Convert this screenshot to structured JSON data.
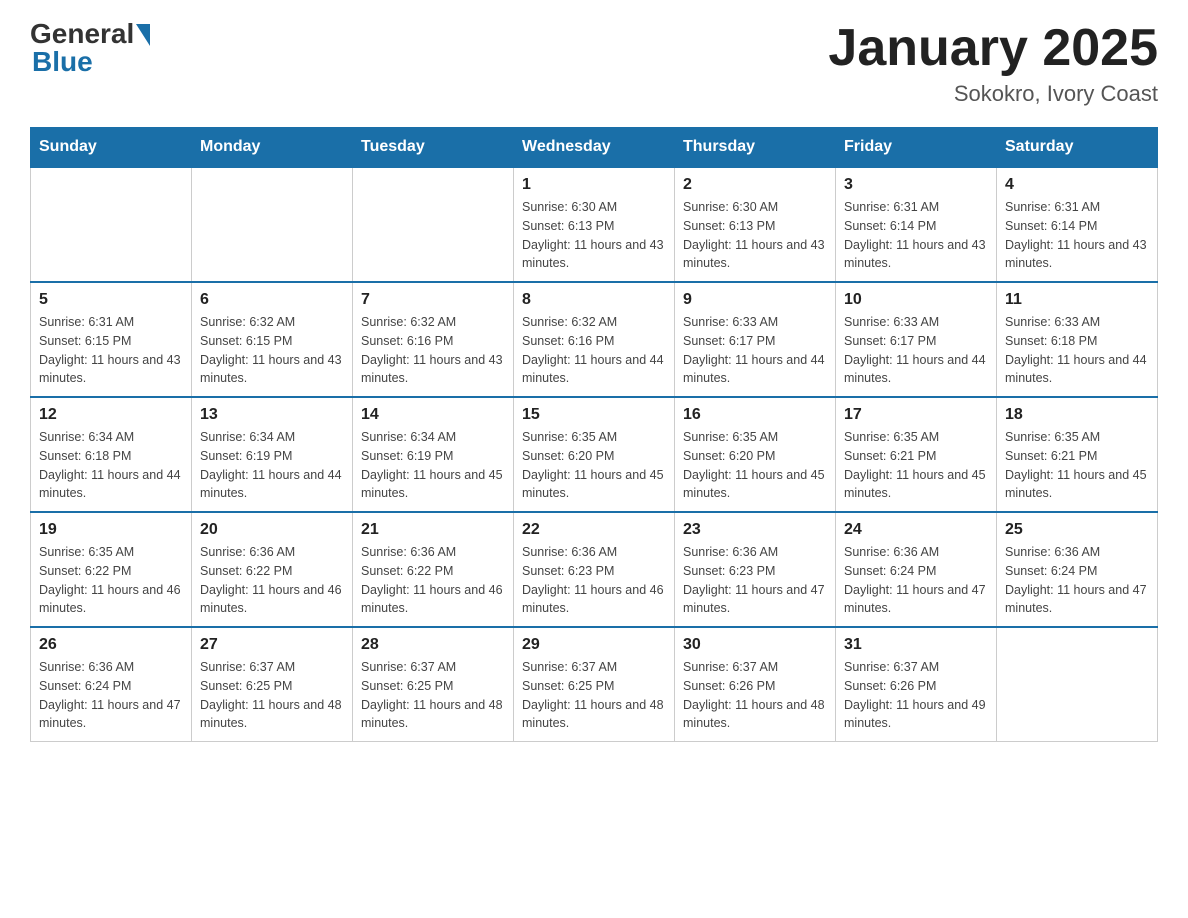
{
  "header": {
    "logo": {
      "general": "General",
      "blue": "Blue"
    },
    "title": "January 2025",
    "subtitle": "Sokokro, Ivory Coast"
  },
  "days_of_week": [
    "Sunday",
    "Monday",
    "Tuesday",
    "Wednesday",
    "Thursday",
    "Friday",
    "Saturday"
  ],
  "weeks": [
    [
      {
        "day": "",
        "info": ""
      },
      {
        "day": "",
        "info": ""
      },
      {
        "day": "",
        "info": ""
      },
      {
        "day": "1",
        "info": "Sunrise: 6:30 AM\nSunset: 6:13 PM\nDaylight: 11 hours and 43 minutes."
      },
      {
        "day": "2",
        "info": "Sunrise: 6:30 AM\nSunset: 6:13 PM\nDaylight: 11 hours and 43 minutes."
      },
      {
        "day": "3",
        "info": "Sunrise: 6:31 AM\nSunset: 6:14 PM\nDaylight: 11 hours and 43 minutes."
      },
      {
        "day": "4",
        "info": "Sunrise: 6:31 AM\nSunset: 6:14 PM\nDaylight: 11 hours and 43 minutes."
      }
    ],
    [
      {
        "day": "5",
        "info": "Sunrise: 6:31 AM\nSunset: 6:15 PM\nDaylight: 11 hours and 43 minutes."
      },
      {
        "day": "6",
        "info": "Sunrise: 6:32 AM\nSunset: 6:15 PM\nDaylight: 11 hours and 43 minutes."
      },
      {
        "day": "7",
        "info": "Sunrise: 6:32 AM\nSunset: 6:16 PM\nDaylight: 11 hours and 43 minutes."
      },
      {
        "day": "8",
        "info": "Sunrise: 6:32 AM\nSunset: 6:16 PM\nDaylight: 11 hours and 44 minutes."
      },
      {
        "day": "9",
        "info": "Sunrise: 6:33 AM\nSunset: 6:17 PM\nDaylight: 11 hours and 44 minutes."
      },
      {
        "day": "10",
        "info": "Sunrise: 6:33 AM\nSunset: 6:17 PM\nDaylight: 11 hours and 44 minutes."
      },
      {
        "day": "11",
        "info": "Sunrise: 6:33 AM\nSunset: 6:18 PM\nDaylight: 11 hours and 44 minutes."
      }
    ],
    [
      {
        "day": "12",
        "info": "Sunrise: 6:34 AM\nSunset: 6:18 PM\nDaylight: 11 hours and 44 minutes."
      },
      {
        "day": "13",
        "info": "Sunrise: 6:34 AM\nSunset: 6:19 PM\nDaylight: 11 hours and 44 minutes."
      },
      {
        "day": "14",
        "info": "Sunrise: 6:34 AM\nSunset: 6:19 PM\nDaylight: 11 hours and 45 minutes."
      },
      {
        "day": "15",
        "info": "Sunrise: 6:35 AM\nSunset: 6:20 PM\nDaylight: 11 hours and 45 minutes."
      },
      {
        "day": "16",
        "info": "Sunrise: 6:35 AM\nSunset: 6:20 PM\nDaylight: 11 hours and 45 minutes."
      },
      {
        "day": "17",
        "info": "Sunrise: 6:35 AM\nSunset: 6:21 PM\nDaylight: 11 hours and 45 minutes."
      },
      {
        "day": "18",
        "info": "Sunrise: 6:35 AM\nSunset: 6:21 PM\nDaylight: 11 hours and 45 minutes."
      }
    ],
    [
      {
        "day": "19",
        "info": "Sunrise: 6:35 AM\nSunset: 6:22 PM\nDaylight: 11 hours and 46 minutes."
      },
      {
        "day": "20",
        "info": "Sunrise: 6:36 AM\nSunset: 6:22 PM\nDaylight: 11 hours and 46 minutes."
      },
      {
        "day": "21",
        "info": "Sunrise: 6:36 AM\nSunset: 6:22 PM\nDaylight: 11 hours and 46 minutes."
      },
      {
        "day": "22",
        "info": "Sunrise: 6:36 AM\nSunset: 6:23 PM\nDaylight: 11 hours and 46 minutes."
      },
      {
        "day": "23",
        "info": "Sunrise: 6:36 AM\nSunset: 6:23 PM\nDaylight: 11 hours and 47 minutes."
      },
      {
        "day": "24",
        "info": "Sunrise: 6:36 AM\nSunset: 6:24 PM\nDaylight: 11 hours and 47 minutes."
      },
      {
        "day": "25",
        "info": "Sunrise: 6:36 AM\nSunset: 6:24 PM\nDaylight: 11 hours and 47 minutes."
      }
    ],
    [
      {
        "day": "26",
        "info": "Sunrise: 6:36 AM\nSunset: 6:24 PM\nDaylight: 11 hours and 47 minutes."
      },
      {
        "day": "27",
        "info": "Sunrise: 6:37 AM\nSunset: 6:25 PM\nDaylight: 11 hours and 48 minutes."
      },
      {
        "day": "28",
        "info": "Sunrise: 6:37 AM\nSunset: 6:25 PM\nDaylight: 11 hours and 48 minutes."
      },
      {
        "day": "29",
        "info": "Sunrise: 6:37 AM\nSunset: 6:25 PM\nDaylight: 11 hours and 48 minutes."
      },
      {
        "day": "30",
        "info": "Sunrise: 6:37 AM\nSunset: 6:26 PM\nDaylight: 11 hours and 48 minutes."
      },
      {
        "day": "31",
        "info": "Sunrise: 6:37 AM\nSunset: 6:26 PM\nDaylight: 11 hours and 49 minutes."
      },
      {
        "day": "",
        "info": ""
      }
    ]
  ]
}
